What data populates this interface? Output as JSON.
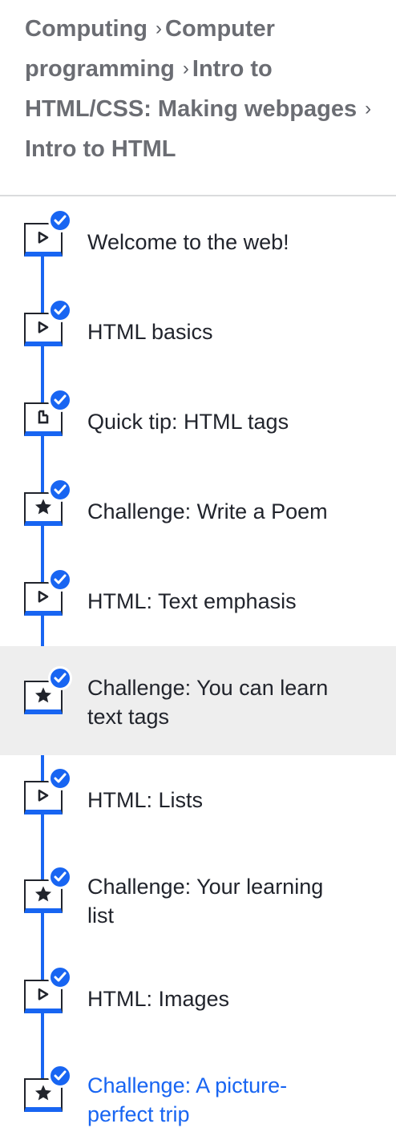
{
  "breadcrumb": {
    "items": [
      "Computing",
      "Computer programming",
      "Intro to HTML/CSS: Making webpages",
      "Intro to HTML"
    ],
    "separator": "›"
  },
  "colors": {
    "accent": "#1865f2",
    "text": "#21242c",
    "muted": "#6b6d73",
    "selected_bg": "#eeeeee",
    "divider": "#dadbdd"
  },
  "lessons": [
    {
      "label": "Welcome to the web!",
      "type": "video",
      "icon": "play-icon",
      "completed": true
    },
    {
      "label": "HTML basics",
      "type": "video",
      "icon": "play-icon",
      "completed": true
    },
    {
      "label": "Quick tip: HTML tags",
      "type": "article",
      "icon": "document-icon",
      "completed": true
    },
    {
      "label": "Challenge: Write a Poem",
      "type": "challenge",
      "icon": "star-icon",
      "completed": true
    },
    {
      "label": "HTML: Text emphasis",
      "type": "video",
      "icon": "play-icon",
      "completed": true
    },
    {
      "label": "Challenge: You can learn text tags",
      "type": "challenge",
      "icon": "star-icon",
      "completed": true,
      "selected": true
    },
    {
      "label": "HTML: Lists",
      "type": "video",
      "icon": "play-icon",
      "completed": true
    },
    {
      "label": "Challenge: Your learning list",
      "type": "challenge",
      "icon": "star-icon",
      "completed": true
    },
    {
      "label": "HTML: Images",
      "type": "video",
      "icon": "play-icon",
      "completed": true
    },
    {
      "label": "Challenge: A picture-perfect trip",
      "type": "challenge",
      "icon": "star-icon",
      "completed": true,
      "current": true
    }
  ]
}
